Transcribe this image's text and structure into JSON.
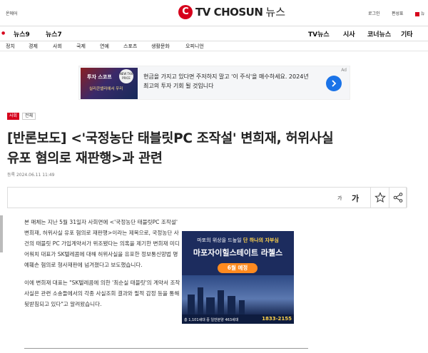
{
  "header": {
    "left_text": "온에어",
    "logo_mark": "C",
    "logo_brand": "TV CHOSUN",
    "logo_suffix": "뉴스",
    "login": "로그인",
    "edition": "편성표",
    "more": "뉴"
  },
  "nav": {
    "items": [
      "뉴스9",
      "뉴스7",
      "TV뉴스",
      "시사",
      "코너뉴스",
      "기타"
    ]
  },
  "categories": [
    "정치",
    "경제",
    "사회",
    "국제",
    "연예",
    "스포츠",
    "생활문화",
    "오피니언"
  ],
  "ad_banner": {
    "thumb_title": "투자 스코프",
    "thumb_sub": "실리콘밸리에서 우리",
    "thumb_circle": "NEW TAX PRICE",
    "text": "현금을 가지고 있다면 주저하지 말고 '이 주식'을 매수하세요. 2024년 최고의 투자 기회 될 것입니다",
    "label": "Ad",
    "go_icon": "chevron-right-icon"
  },
  "article": {
    "section": "사회",
    "subsection": "전체",
    "headline": "[반론보도] <'국정농단 태블릿PC 조작설' 변희재, 허위사실 유포 혐의로 재판행>과 관련",
    "byline": "등록 2024.06.11 11:49",
    "paragraph1": "본 매체는 지난 5월 31일자 사회면에 <'국정농단 태블릿PC 조작설' 변희재, 허위사실 유포 혐의로 재판행>이라는 제목으로, 국정농단 사건의 태블릿 PC 가입계약서가 위조됐다는 의혹을 제기한 변희재 미디어워치 대표가 SK텔레콤에 대해 허위사실을 유포한 정보통신망법 명예훼손 혐의로 형사재판에 넘겨졌다고 보도했습니다.",
    "paragraph2": "이에 변희재 대표는 \"SK텔레콤에 의한 '최순실 태블릿'의 계약서 조작 사실은 관련 소송들에서의 각종 사실조회 결과와 필적 감정 등을 통해 뒷받침되고 있다\"고 알려왔습니다."
  },
  "toolbar": {
    "font_small": "가",
    "font_large": "가",
    "icons": [
      "star-icon",
      "share-icon",
      "print-icon"
    ]
  },
  "inline_ad": {
    "line1_a": "마포의 위상을 드높일",
    "line1_b": "단 하나의 자부심",
    "line2": "마포자이힐스테이트 라첼스",
    "pill": "6월 예정",
    "footer": "총 1,101세대 중 일반분양 463세대",
    "phone": "1833-2155"
  },
  "colors": {
    "brand_red": "#d6001c",
    "ad_blue": "#1a73e8",
    "inline_ad_bg": "#1c2c5e"
  }
}
